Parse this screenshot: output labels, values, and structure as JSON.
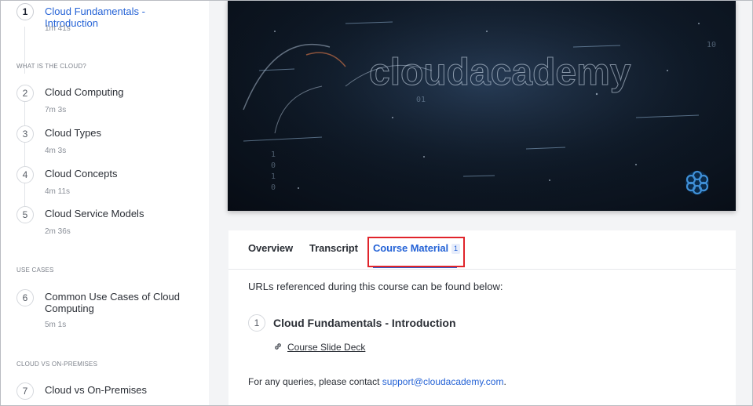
{
  "sidebar": {
    "lessons": [
      {
        "num": "1",
        "title": "Cloud Fundamentals - Introduction",
        "duration": "1m 41s"
      },
      {
        "num": "2",
        "title": "Cloud Computing",
        "duration": "7m 3s"
      },
      {
        "num": "3",
        "title": "Cloud Types",
        "duration": "4m 3s"
      },
      {
        "num": "4",
        "title": "Cloud Concepts",
        "duration": "4m 11s"
      },
      {
        "num": "5",
        "title": "Cloud Service Models",
        "duration": "2m 36s"
      },
      {
        "num": "6",
        "title": "Common Use Cases of Cloud Computing",
        "duration": "5m 1s"
      },
      {
        "num": "7",
        "title": "Cloud vs On-Premises",
        "duration": ""
      }
    ],
    "sections": {
      "what_is_cloud": "WHAT IS THE CLOUD?",
      "use_cases": "USE CASES",
      "cloud_vs_onprem": "CLOUD VS ON-PREMISES"
    }
  },
  "video": {
    "watermark_text": "cloudacademy",
    "logo_icon": "cloud-academy-logo-icon"
  },
  "tabs": [
    {
      "label": "Overview"
    },
    {
      "label": "Transcript"
    },
    {
      "label": "Course Material",
      "badge": "1"
    }
  ],
  "content": {
    "intro": "URLs referenced during this course can be found below:",
    "resource": {
      "num": "1",
      "title": "Cloud Fundamentals - Introduction",
      "link_icon": "link-icon",
      "link_label": "Course Slide Deck"
    },
    "contact_prefix": "For any queries, please contact ",
    "contact_email": "support@cloudacademy.com",
    "contact_suffix": "."
  },
  "colors": {
    "accent": "#2563d6",
    "highlight": "#e0242b"
  }
}
